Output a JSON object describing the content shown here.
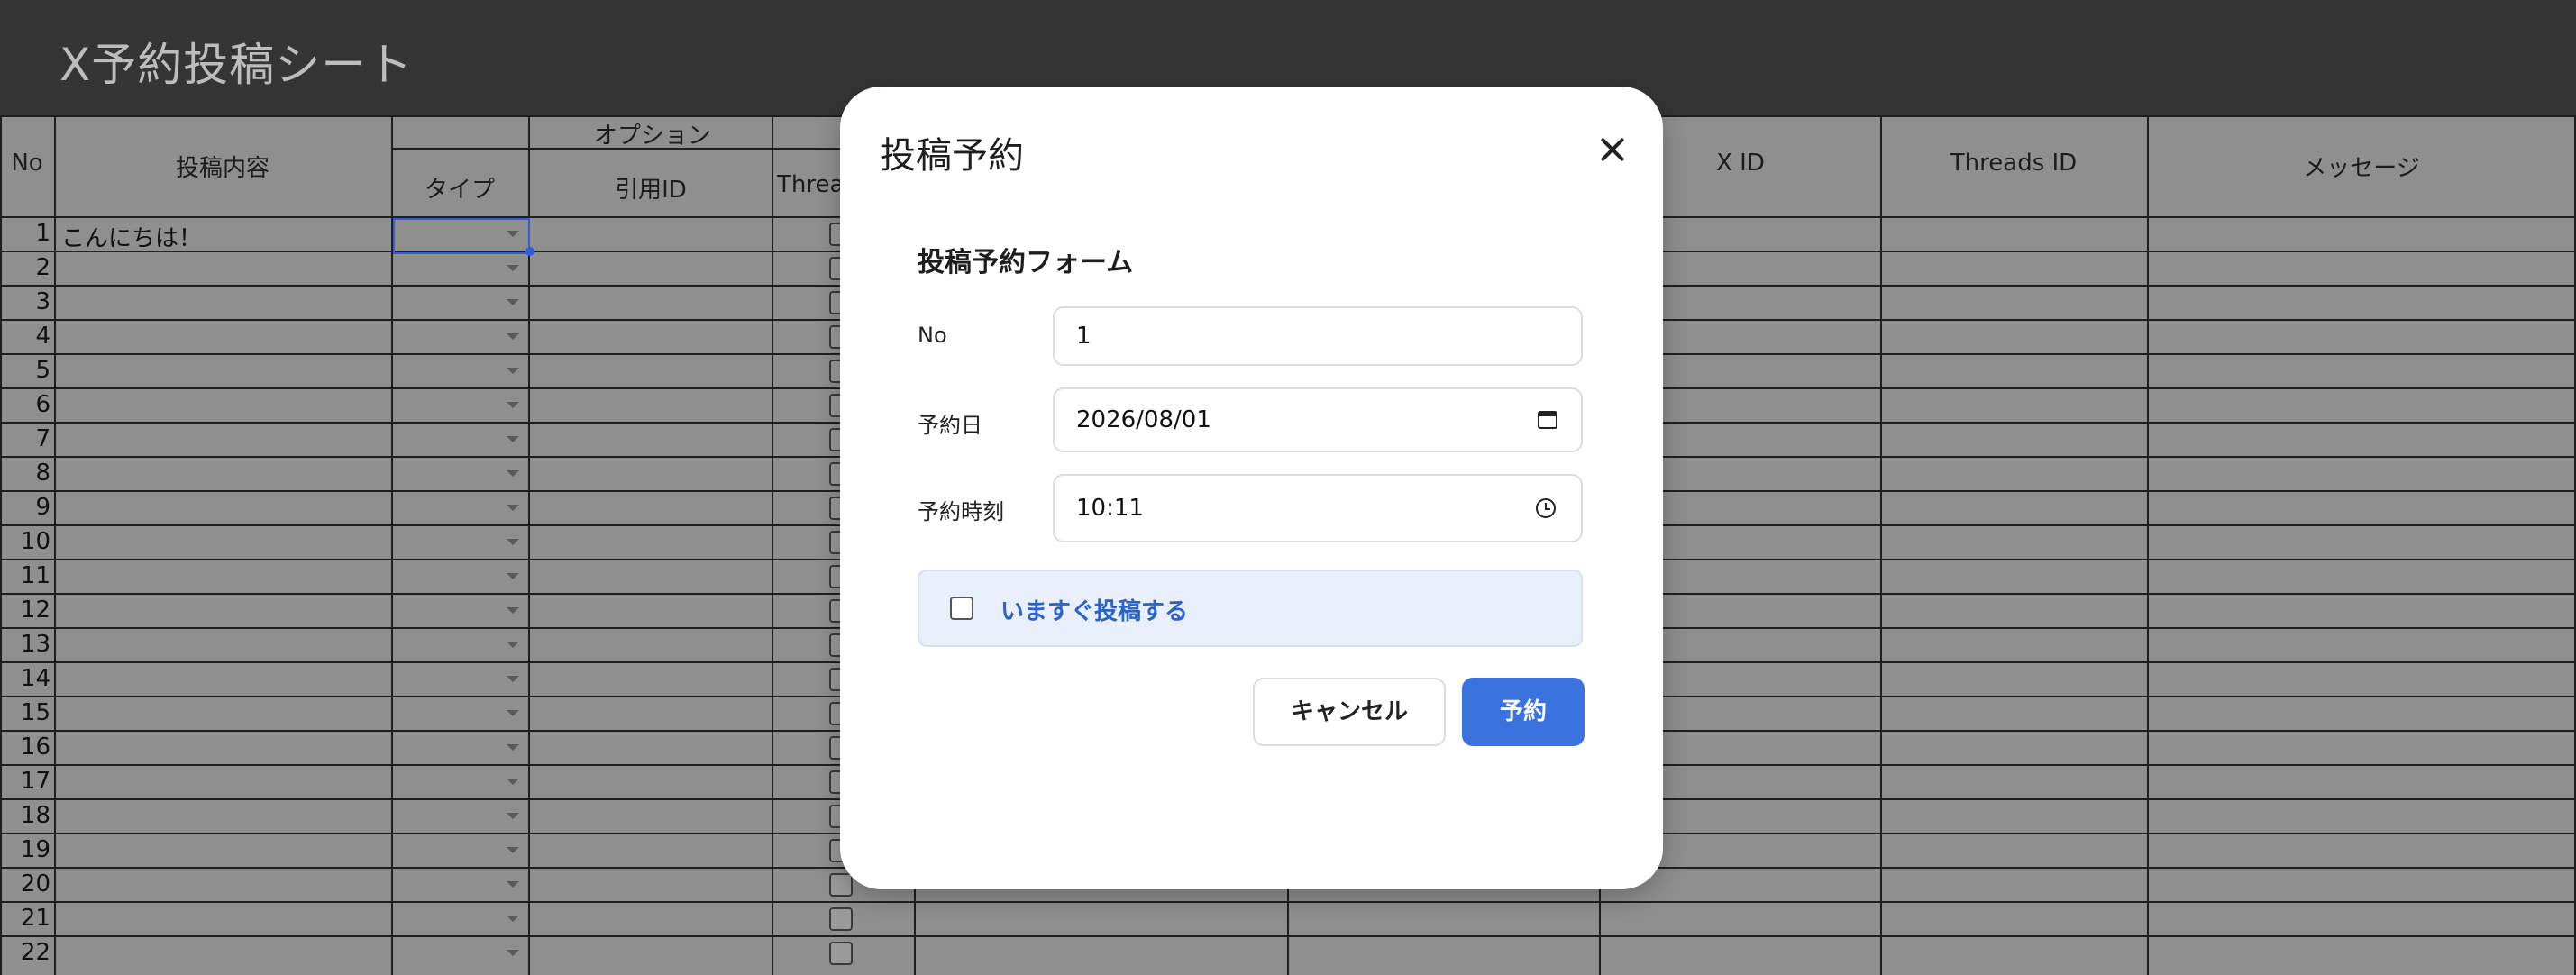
{
  "app": {
    "title": "X予約投稿シート"
  },
  "sheet": {
    "headers": {
      "no": "No",
      "content": "投稿内容",
      "options_group": "オプション",
      "type": "タイプ",
      "quote_id": "引用ID",
      "threads_partial": "Threa",
      "x_id": "X ID",
      "threads_id": "Threads ID",
      "message": "メッセージ"
    },
    "rows": [
      1,
      2,
      3,
      4,
      5,
      6,
      7,
      8,
      9,
      10,
      11,
      12,
      13,
      14,
      15,
      16,
      17,
      18,
      19,
      20,
      21,
      22
    ],
    "first_row_content": "こんにちは！"
  },
  "modal": {
    "title": "投稿予約",
    "close_icon": "close-icon",
    "form_title": "投稿予約フォーム",
    "no_label": "No",
    "no_value": "1",
    "date_label": "予約日",
    "date_value": "2026/08/01",
    "time_label": "予約時刻",
    "time_value": "10:11",
    "post_now_label": "いますぐ投稿する",
    "post_now_checked": false,
    "cancel_label": "キャンセル",
    "submit_label": "予約",
    "accent_color": "#3a73de"
  }
}
